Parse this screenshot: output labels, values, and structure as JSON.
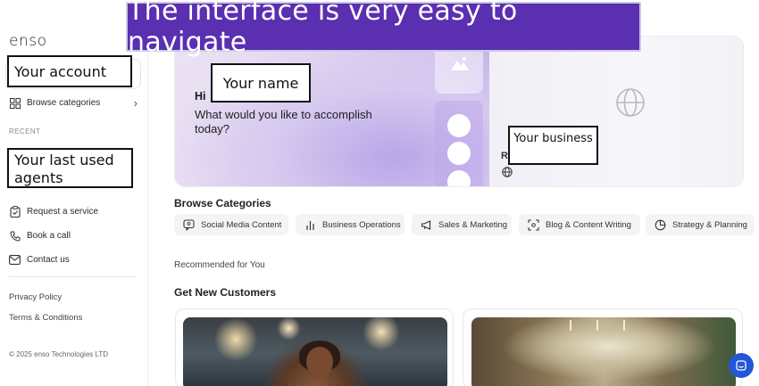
{
  "banner": {
    "text": "The interface is very easy to navigate"
  },
  "sidebar": {
    "logo": "enso",
    "browse_label": "Browse categories",
    "recent_label": "RECENT",
    "items": [
      {
        "label": "Request a service",
        "icon": "clipboard-check-icon"
      },
      {
        "label": "Book a call",
        "icon": "phone-icon"
      },
      {
        "label": "Contact us",
        "icon": "mail-icon"
      }
    ],
    "privacy": "Privacy Policy",
    "terms": "Terms & Conditions",
    "copyright": "© 2025 enso Technologies LTD"
  },
  "hero": {
    "greeting": "Hi",
    "question": "What would you like to accomplish today?",
    "right_letter": "R"
  },
  "callouts": {
    "account": "Your account",
    "recent": "Your last used agents",
    "name": "Your name",
    "business": "Your business"
  },
  "categories": {
    "title": "Browse Categories",
    "chips": [
      {
        "label": "Social Media Content",
        "icon": "chat-bubble-icon"
      },
      {
        "label": "Business Operations",
        "icon": "bar-chart-icon"
      },
      {
        "label": "Sales & Marketing",
        "icon": "megaphone-icon"
      },
      {
        "label": "Blog & Content Writing",
        "icon": "scan-icon"
      },
      {
        "label": "Strategy & Planning",
        "icon": "pie-chart-icon"
      }
    ]
  },
  "recommended_label": "Recommended for You",
  "section_title": "Get New Customers",
  "colors": {
    "banner": "#5a2fb0",
    "accent": "#2457d6"
  }
}
